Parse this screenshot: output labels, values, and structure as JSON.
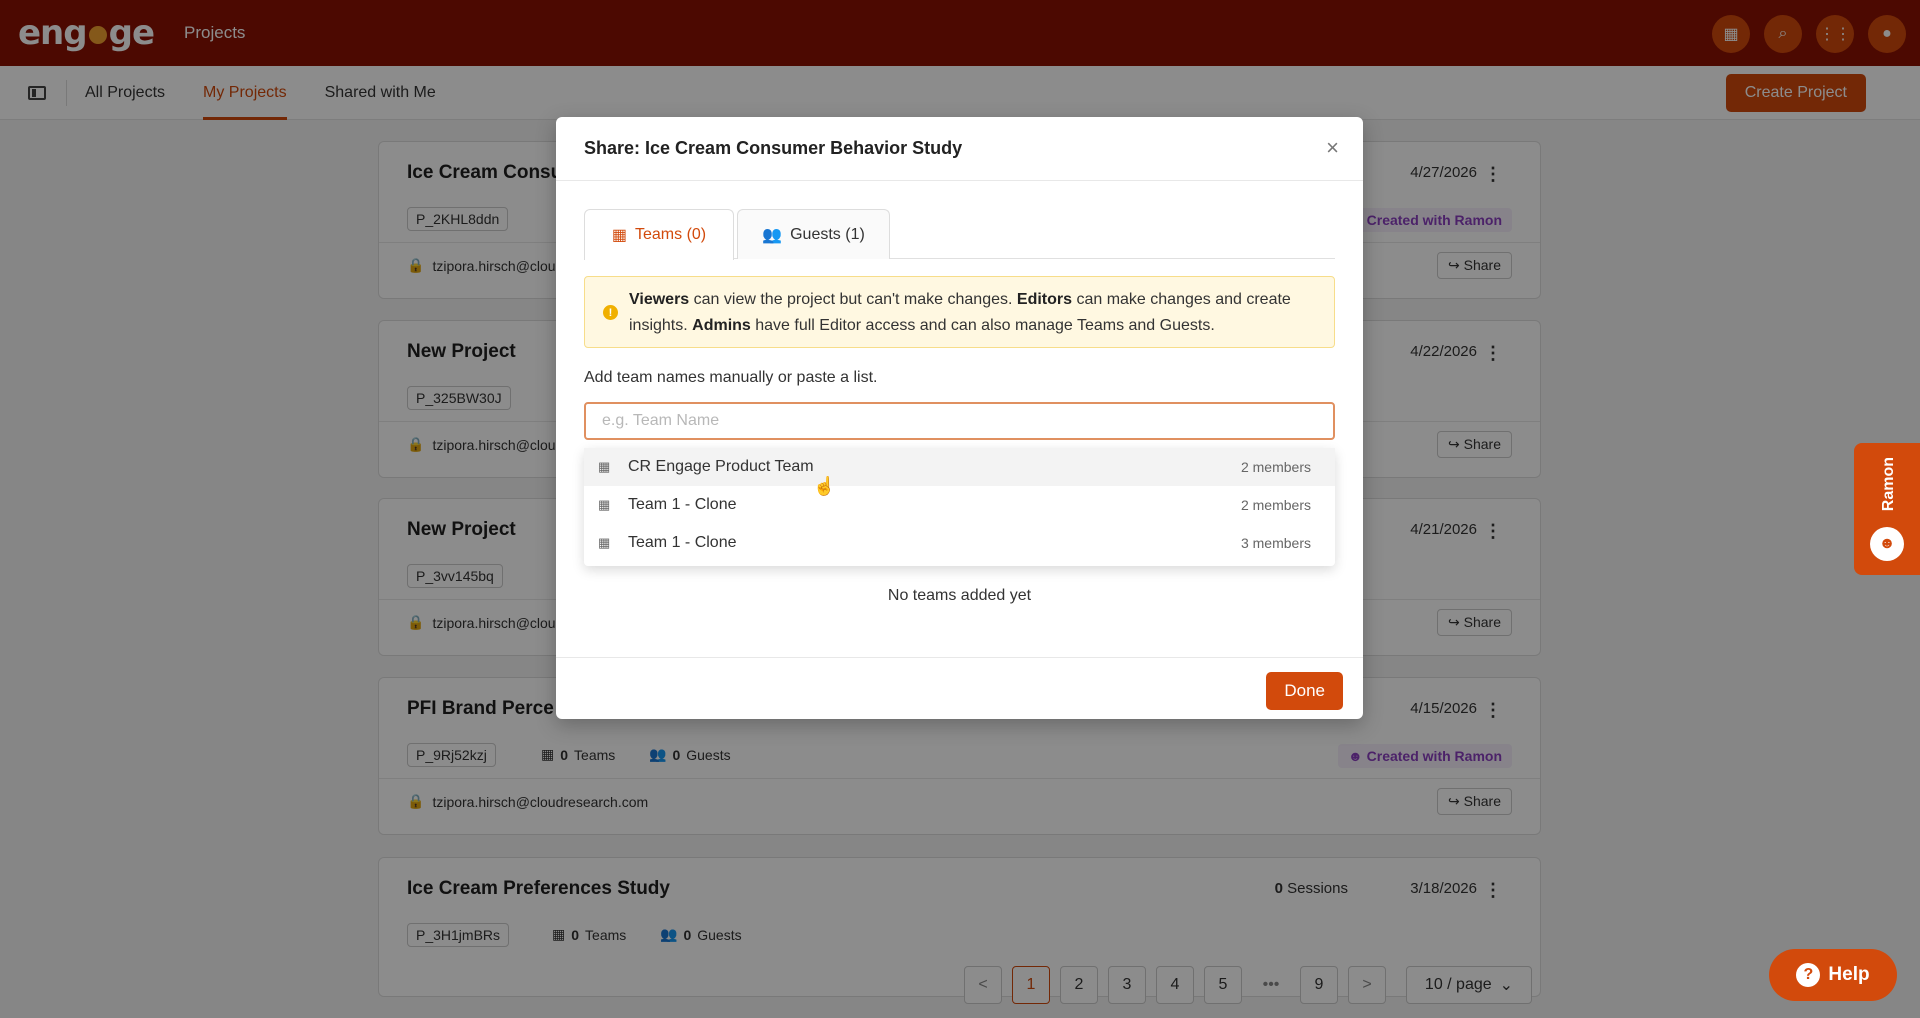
{
  "app": {
    "logo_text": "engage",
    "section": "Projects"
  },
  "topbar_icons": [
    "team-icon",
    "search-icon",
    "apps-grid-icon",
    "user-icon"
  ],
  "subnav": {
    "tabs": [
      {
        "label": "All Projects"
      },
      {
        "label": "My Projects",
        "active": true
      },
      {
        "label": "Shared with Me"
      }
    ],
    "create_label": "Create Project"
  },
  "projects": [
    {
      "title": "Ice Cream Consu",
      "date": "4/27/2026",
      "pid": "P_2KHL8ddn",
      "email": "tzipora.hirsch@cloud",
      "ramon": "Created with Ramon",
      "share": "Share"
    },
    {
      "title": "New Project",
      "date": "4/22/2026",
      "pid": "P_325BW30J",
      "email": "tzipora.hirsch@cloud",
      "share": "Share"
    },
    {
      "title": "New Project",
      "date": "4/21/2026",
      "pid": "P_3vv145bq",
      "email": "tzipora.hirsch@cloud",
      "share": "Share"
    },
    {
      "title": "PFI Brand Perce",
      "date": "4/15/2026",
      "pid": "P_9Rj52kzj",
      "teams": "0",
      "teams_label": "Teams",
      "guests": "0",
      "guests_label": "Guests",
      "email": "tzipora.hirsch@cloudresearch.com",
      "ramon": "Created with Ramon",
      "share": "Share"
    },
    {
      "title": "Ice Cream Preferences Study",
      "sessions": "0",
      "sessions_label": "Sessions",
      "date": "3/18/2026",
      "pid": "P_3H1jmBRs",
      "teams": "0",
      "teams_label": "Teams",
      "guests": "0",
      "guests_label": "Guests"
    }
  ],
  "pagination": {
    "pages": [
      "1",
      "2",
      "3",
      "4",
      "5",
      "9"
    ],
    "current": "1",
    "ellipsis": "•••",
    "prev": "<",
    "next": ">",
    "per_page": "10 / page"
  },
  "ramon_tab": {
    "label": "Ramon"
  },
  "help": {
    "label": "Help"
  },
  "modal": {
    "title": "Share: Ice Cream Consumer Behavior Study",
    "tabs": [
      {
        "label": "Teams (0)",
        "active": true
      },
      {
        "label": "Guests (1)"
      }
    ],
    "notice": {
      "viewers": "Viewers",
      "text1": " can view the project but can't make changes. ",
      "editors": "Editors",
      "text2": " can make changes and create insights. ",
      "admins": "Admins",
      "text3": " have full Editor access and can also manage Teams and Guests."
    },
    "add_label": "Add team names manually or paste a list.",
    "input_placeholder": "e.g. Team Name",
    "input_value": "",
    "empty_text": "No teams added yet",
    "done_label": "Done"
  },
  "dropdown": [
    {
      "name": "CR Engage Product Team",
      "members": "2 members",
      "hover": true
    },
    {
      "name": "Team 1 - Clone",
      "members": "2 members"
    },
    {
      "name": "Team 1 - Clone",
      "members": "3 members"
    }
  ],
  "colors": {
    "brand": "#8a1203",
    "accent": "#d24a0c",
    "ramon": "#8a3fc0"
  }
}
